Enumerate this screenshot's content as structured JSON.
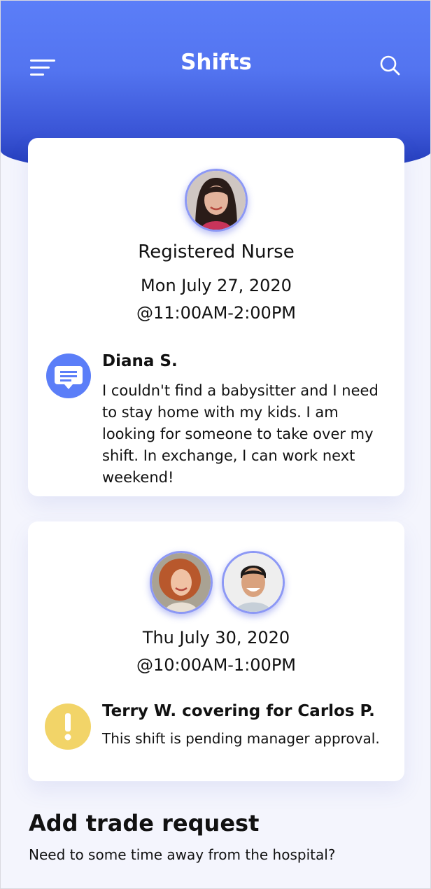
{
  "header": {
    "title": "Shifts",
    "menu_icon": "menu-icon",
    "search_icon": "search-icon",
    "gradient_top": "#5b7ef8",
    "gradient_bottom": "#1e37b4"
  },
  "shift_post": {
    "role": "Registered Nurse",
    "date": "Mon July 27, 2020",
    "time": "@11:00AM-2:00PM",
    "message_icon": "chat-bubble-icon",
    "sender": "Diana S.",
    "message": "I couldn't find a babysitter and I need to stay home with my kids. I am looking for someone to take over my shift. In exchange, I can work next weekend!"
  },
  "trade": {
    "date": "Thu July 30, 2020",
    "time": "@10:00AM-1:00PM",
    "status_icon": "exclamation-icon",
    "title": "Terry W. covering for Carlos P.",
    "status": "This shift is pending manager approval."
  },
  "add_trade": {
    "title": "Add trade request",
    "subtitle": "Need to some time away from the hospital?"
  },
  "colors": {
    "accent": "#5b7ef8",
    "warning": "#f2d468",
    "background": "#f4f5fd"
  }
}
